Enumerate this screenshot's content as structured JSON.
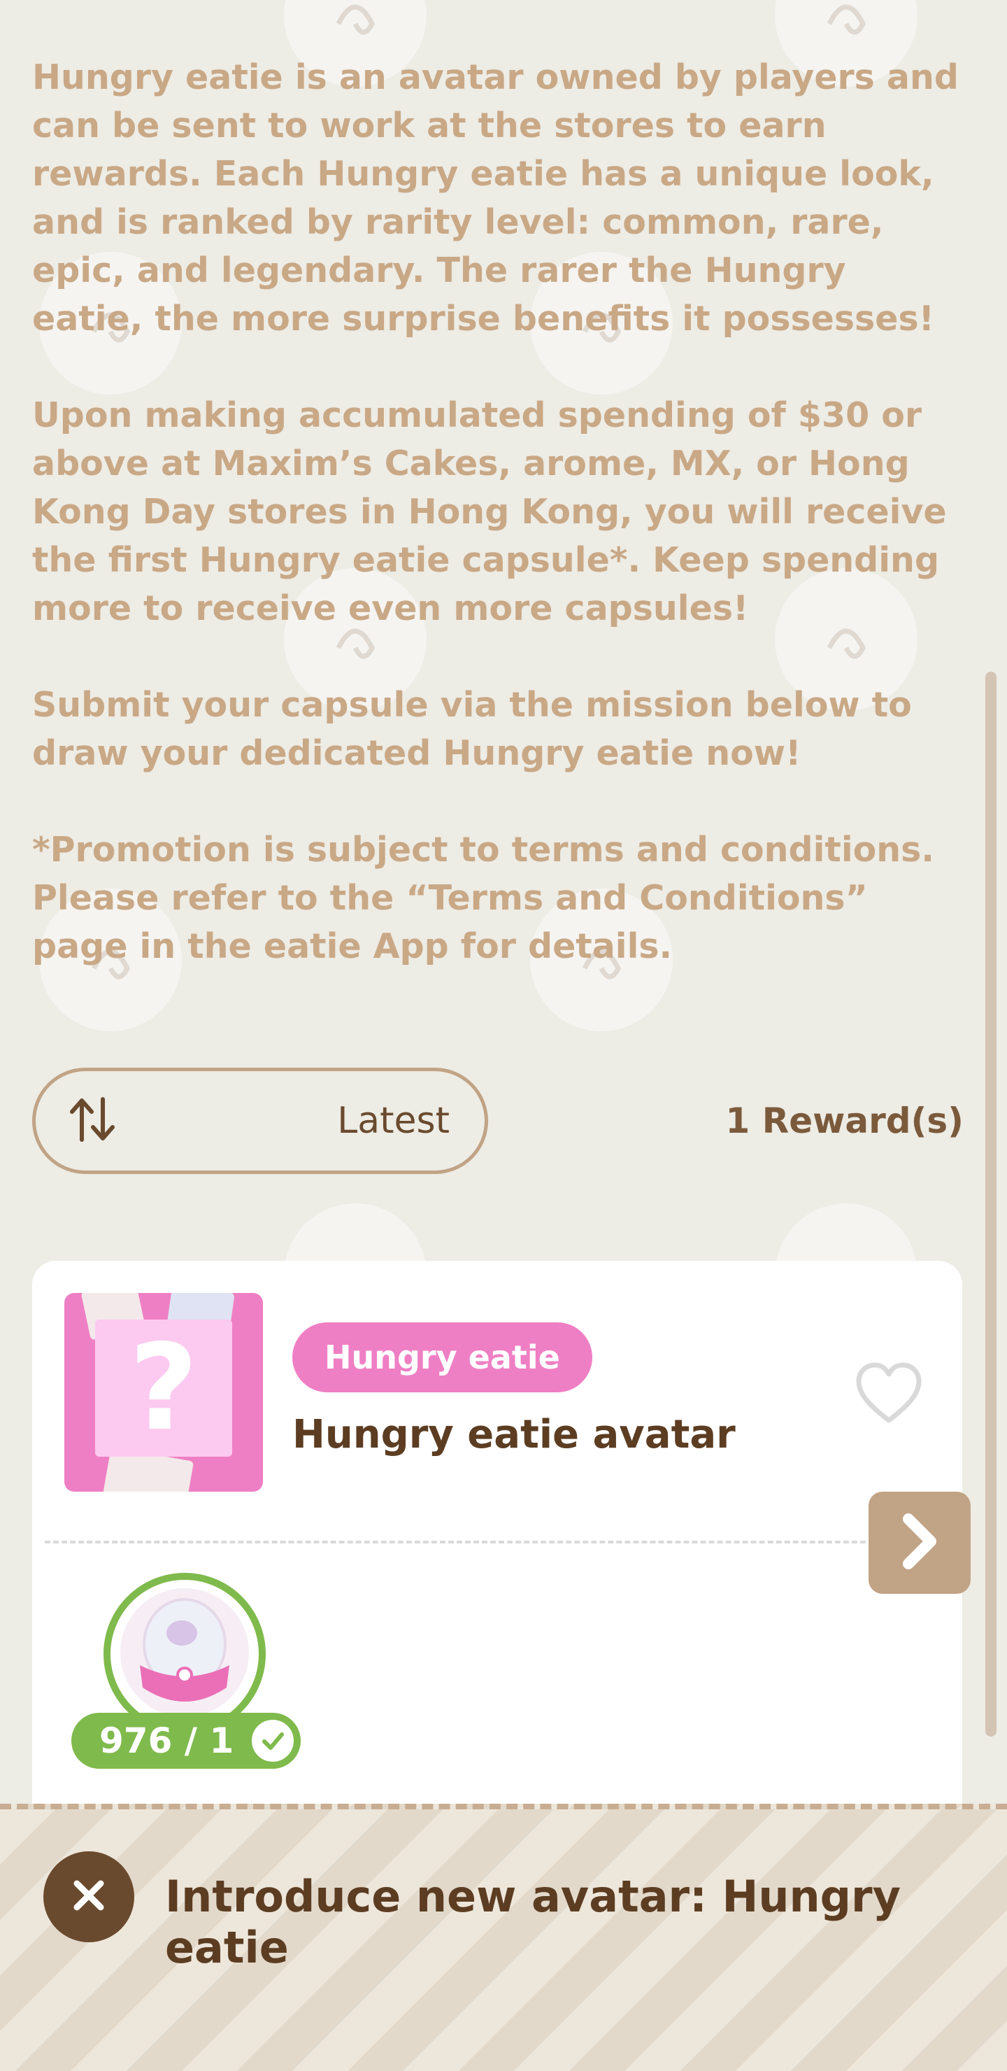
{
  "intro": {
    "paragraphs": [
      "Hungry eatie is an avatar owned by players and can be sent to work at the stores to earn rewards. Each Hungry eatie has a unique look, and is ranked by rarity level: common, rare, epic, and legendary. The rarer the Hungry eatie, the more surprise benefits it possesses!",
      "Upon making accumulated spending of $30 or above at Maxim’s Cakes, arome, MX, or Hong Kong Day stores in Hong Kong, you will receive the first Hungry eatie capsule*. Keep spending more to receive even more capsules!",
      "Submit your capsule via the mission below to draw your dedicated Hungry eatie now!",
      "*Promotion is subject to terms and conditions. Please refer to the “Terms and Conditions” page in the eatie App for details."
    ]
  },
  "sort": {
    "icon": "sort-arrows-icon",
    "label": "Latest"
  },
  "reward_count": "1 Reward(s)",
  "reward_card": {
    "tag": "Hungry eatie",
    "title": "Hungry eatie avatar",
    "thumbnail_symbol": "?",
    "capsule_progress": "976 / 1",
    "icons": [
      "heart-icon",
      "chevron-right-icon",
      "capsule-icon",
      "check-icon"
    ]
  },
  "footer": {
    "title": "Introduce new avatar: Hungry eatie",
    "close_icon": "close-icon"
  },
  "colors": {
    "background": "#edece5",
    "intro_text": "#c9a886",
    "brown": "#6a4a2e",
    "tan": "#c1a385",
    "pink": "#ef7fc4",
    "green": "#7fba4c"
  }
}
